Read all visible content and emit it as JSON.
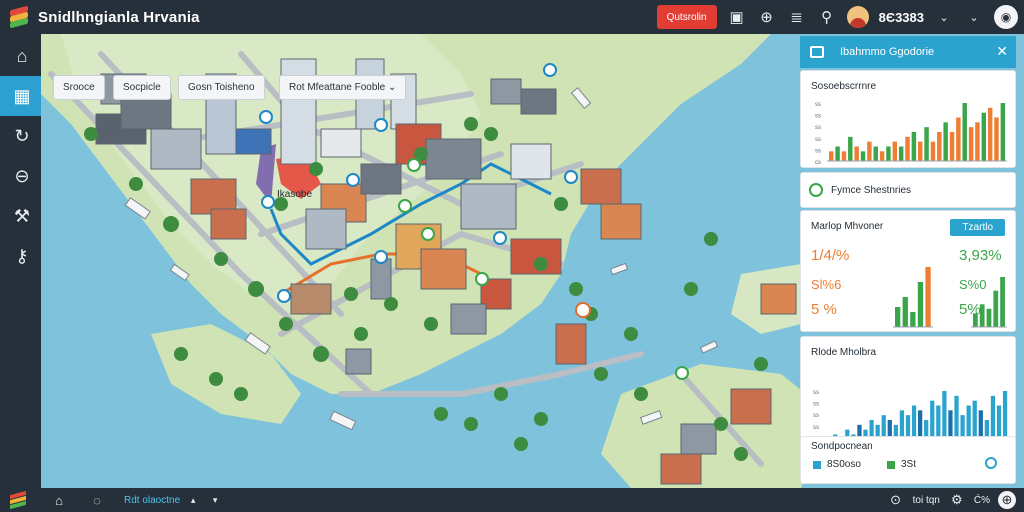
{
  "app": {
    "title": "Snidlhngianla Hrvania"
  },
  "topbar": {
    "action_button": "Qutsrolin",
    "icons": [
      "image-icon",
      "compass-icon",
      "list-icon",
      "pin-icon"
    ],
    "user_score": "8Є3383",
    "controls": [
      "chevron-down-icon",
      "chevron-down-icon"
    ]
  },
  "leftrail": {
    "items": [
      {
        "icon": "home-icon",
        "active": false
      },
      {
        "icon": "layers-icon",
        "active": true
      },
      {
        "icon": "refresh-icon",
        "active": false
      },
      {
        "icon": "minus-circle-icon",
        "active": false
      },
      {
        "icon": "tools-icon",
        "active": false
      },
      {
        "icon": "key-icon",
        "active": false
      }
    ]
  },
  "map": {
    "chips": [
      {
        "label": "Srooce"
      },
      {
        "label": "Socpicle"
      },
      {
        "label": "Gosn   Toisheno"
      },
      {
        "label": "Rot   Mfeattane Fooble ⌄"
      }
    ],
    "label_marker": "Ikasobe",
    "controls": [
      "✕",
      "⋏",
      "+",
      "⋎"
    ]
  },
  "panel": {
    "header": "Ibahmmo Ggodorie",
    "card1": {
      "title": "Sosoebscrrnre",
      "y_ticks": [
        "ss",
        "ss",
        "ss",
        "ss",
        "ss",
        "cs"
      ],
      "values": [
        2,
        3,
        2,
        5,
        3,
        2,
        4,
        3,
        2,
        3,
        4,
        3,
        5,
        6,
        4,
        7,
        4,
        6,
        8,
        6,
        9,
        12,
        7,
        8,
        10,
        11,
        9,
        12
      ]
    },
    "card2": {
      "title": "Fymce Shestnries"
    },
    "card3": {
      "title": "Marlop Mhvoner",
      "button": "Tzartlo",
      "left_values": [
        "1/4/%",
        "Sl%6",
        "5 %"
      ],
      "right_values": [
        "3,93%",
        "S%0",
        "5%"
      ],
      "chart_a": [
        4,
        6,
        3,
        9,
        12
      ],
      "chart_b": [
        3,
        5,
        4,
        8,
        11
      ]
    },
    "card4": {
      "title": "Rlode Mholbra",
      "y_ticks": [
        "ss",
        "ss",
        "ss",
        "ss",
        "ss",
        "ss"
      ],
      "values": [
        2,
        3,
        2,
        4,
        3,
        5,
        4,
        6,
        5,
        7,
        6,
        5,
        8,
        7,
        9,
        8,
        6,
        10,
        9,
        12,
        8,
        11,
        7,
        9,
        10,
        8,
        6,
        11,
        9,
        12
      ]
    },
    "card5": {
      "title": "Sondpocnean",
      "items": [
        "8S0oso",
        "3St"
      ]
    }
  },
  "bottombar": {
    "label": "Rdt olaoctne",
    "right_text": "toi tqn",
    "right_icons": [
      "help-icon",
      "settings-icon"
    ],
    "right_extra": "Ć%"
  },
  "colors": {
    "bar_dark": "#26303b",
    "accent": "#2aa3cf",
    "alert": "#e23d34",
    "green": "#3aa54a",
    "orange": "#ee7e33"
  }
}
